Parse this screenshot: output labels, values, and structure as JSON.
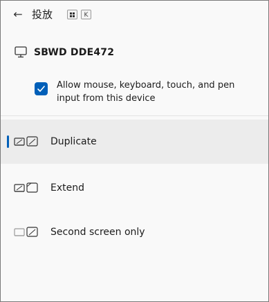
{
  "header": {
    "back_glyph": "←",
    "title": "投放",
    "shortcut_key": "K",
    "win_key_icon": "windows-logo-icon"
  },
  "device": {
    "name": "SBWD DDE472",
    "icon": "monitor-icon"
  },
  "input_option": {
    "label": "Allow mouse, keyboard, touch, and pen input from this device",
    "checked": true
  },
  "modes": [
    {
      "label": "Duplicate",
      "icon": "duplicate-screens-icon",
      "selected": true
    },
    {
      "label": "Extend",
      "icon": "extend-screens-icon",
      "selected": false
    },
    {
      "label": "Second screen only",
      "icon": "second-screen-only-icon",
      "selected": false
    }
  ],
  "colors": {
    "accent": "#005fb8",
    "selected_bg": "#ececec",
    "panel_bg": "#f9f9f9"
  }
}
